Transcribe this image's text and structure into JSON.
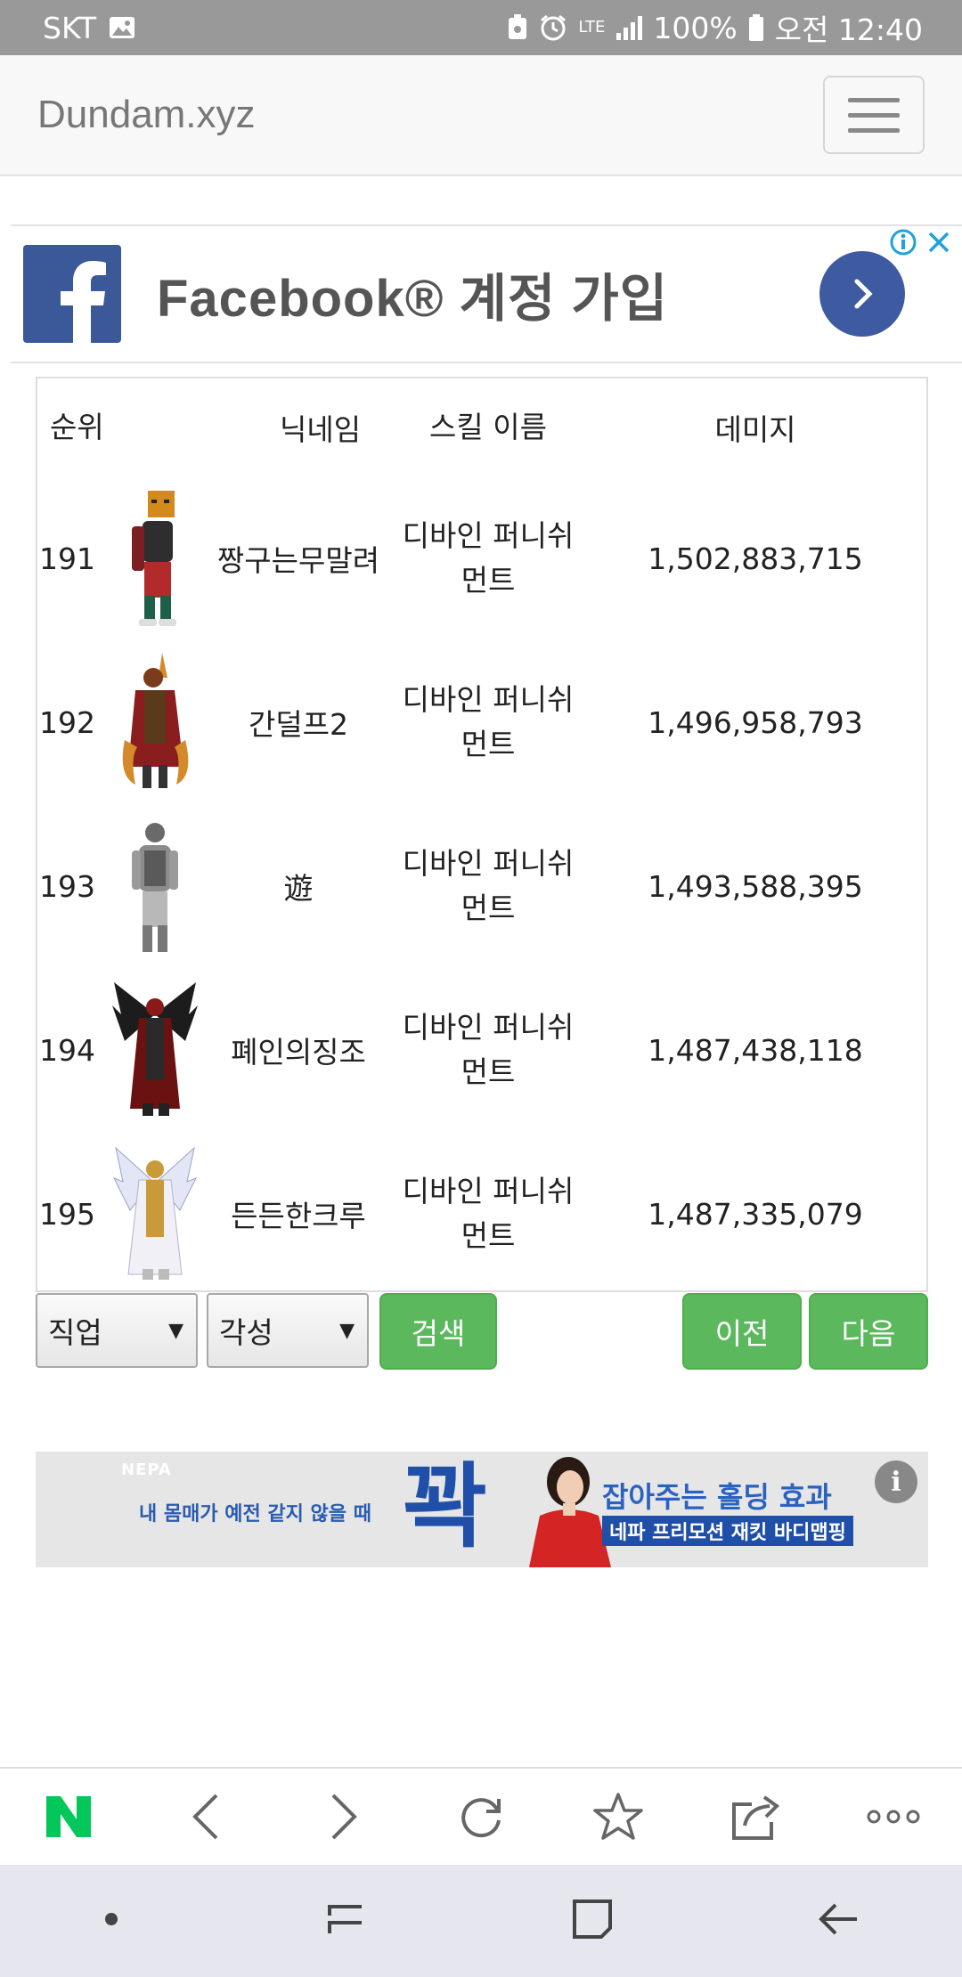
{
  "status_bar": {
    "carrier": "SKT",
    "network": "LTE",
    "battery": "100%",
    "time": "오전 12:40"
  },
  "navbar": {
    "brand": "Dundam.xyz"
  },
  "fb_ad": {
    "text": "Facebook® 계정 가입"
  },
  "table": {
    "headers": {
      "rank": "순위",
      "nickname": "닉네임",
      "skill": "스킬 이름",
      "damage": "데미지"
    },
    "rows": [
      {
        "rank": "191",
        "nickname": "짱구는무말려",
        "skill": "디바인 퍼니쉬먼트",
        "damage": "1,502,883,715"
      },
      {
        "rank": "192",
        "nickname": "간덜프2",
        "skill": "디바인 퍼니쉬먼트",
        "damage": "1,496,958,793"
      },
      {
        "rank": "193",
        "nickname": "遊",
        "skill": "디바인 퍼니쉬먼트",
        "damage": "1,493,588,395"
      },
      {
        "rank": "194",
        "nickname": "폐인의징조",
        "skill": "디바인 퍼니쉬먼트",
        "damage": "1,487,438,118"
      },
      {
        "rank": "195",
        "nickname": "든든한크루",
        "skill": "디바인 퍼니쉬먼트",
        "damage": "1,487,335,079"
      }
    ]
  },
  "controls": {
    "job_select": "직업",
    "awaken_select": "각성",
    "search_button": "검색",
    "prev_button": "이전",
    "next_button": "다음"
  },
  "nepa_ad": {
    "logo": "NEPA",
    "sub": "내 몸매가 예전 같지 않을 때",
    "big": "꽉",
    "headline": "잡아주는 홀딩 효과",
    "tag": "네파 프리모션 재킷 바디맵핑"
  },
  "colors": {
    "status_bar": "#999999",
    "navbar_bg": "#f8f8f8",
    "facebook_blue": "#3b5998",
    "button_green": "#5cb85c",
    "android_nav": "#e6e6ef"
  }
}
